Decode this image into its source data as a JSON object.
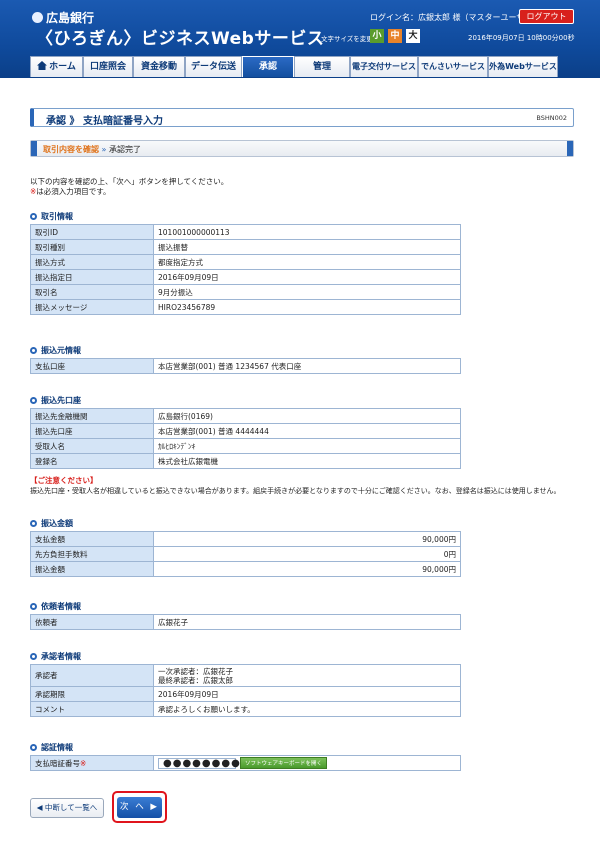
{
  "header": {
    "bank_name": "広島銀行",
    "service_name": "〈ひろぎん〉ビジネスWebサービス",
    "login_info": "ログイン名：広銀太郎 様（マスターユーザ）",
    "logout_label": "ログアウト",
    "font_size_label": "文字サイズを変更",
    "font_small": "小",
    "font_medium": "中",
    "font_large": "大",
    "datetime": "2016年09月07日 10時00分00秒"
  },
  "nav": {
    "tabs": [
      {
        "label": "ホーム"
      },
      {
        "label": "口座照会"
      },
      {
        "label": "資金移動"
      },
      {
        "label": "データ伝送"
      },
      {
        "label": "承認"
      },
      {
        "label": "管理"
      },
      {
        "label": "電子交付サービス"
      },
      {
        "label": "でんさいサービス"
      },
      {
        "label": "外為Webサービス"
      }
    ],
    "active_tab": "承認"
  },
  "page": {
    "title": "承認 》 支払暗証番号入力",
    "screen_id": "BSHN002",
    "step_current": "取引内容を確認",
    "step_sep": "»",
    "step_next": "承認完了",
    "intro_line1": "以下の内容を確認の上、「次へ」ボタンを押してください。",
    "intro_required_mark": "※",
    "intro_line2": "は必須入力項目です。"
  },
  "sections": {
    "transaction": {
      "title": "取引情報",
      "rows": [
        {
          "label": "取引ID",
          "value": "101001000000113"
        },
        {
          "label": "取引種別",
          "value": "振込振替"
        },
        {
          "label": "振込方式",
          "value": "都度指定方式"
        },
        {
          "label": "振込指定日",
          "value": "2016年09月09日"
        },
        {
          "label": "取引名",
          "value": "9月分振込"
        },
        {
          "label": "振込メッセージ",
          "value": "HIRO23456789"
        }
      ]
    },
    "source": {
      "title": "振込元情報",
      "rows": [
        {
          "label": "支払口座",
          "value": "本店営業部(001) 普通 1234567 代表口座"
        }
      ]
    },
    "destination": {
      "title": "振込先口座",
      "rows": [
        {
          "label": "振込先金融機関",
          "value": "広島銀行(0169)"
        },
        {
          "label": "振込先口座",
          "value": "本店営業部(001) 普通 4444444"
        },
        {
          "label": "受取人名",
          "value": "ｶﾙﾋﾛｷﾝﾃﾞﾝｷ"
        },
        {
          "label": "登録名",
          "value": "株式会社広銀電機"
        }
      ],
      "caution_title": "【ご注意ください】",
      "caution_text": "振込先口座・受取人名が相違していると振込できない場合があります。組戻手続きが必要となりますので十分にご確認ください。なお、登録名は振込には使用しません。"
    },
    "amount": {
      "title": "振込金額",
      "rows": [
        {
          "label": "支払金額",
          "value": "90,000円"
        },
        {
          "label": "先方負担手数料",
          "value": "0円"
        },
        {
          "label": "振込金額",
          "value": "90,000円"
        }
      ]
    },
    "requester": {
      "title": "依頼者情報",
      "rows": [
        {
          "label": "依頼者",
          "value": "広銀花子"
        }
      ]
    },
    "approver": {
      "title": "承認者情報",
      "approver_label": "承認者",
      "approver_line1": "一次承認者：広銀花子",
      "approver_line2": "最終承認者：広銀太郎",
      "deadline_label": "承認期限",
      "deadline_value": "2016年09月09日",
      "comment_label": "コメント",
      "comment_value": "承認よろしくお願いします。"
    },
    "auth": {
      "title": "認証情報",
      "pin_label": "支払暗証番号",
      "pin_required": "※",
      "pin_value": "●●●●●●●●",
      "keyboard_label": "ソフトウェアキーボードを開く"
    }
  },
  "buttons": {
    "back_label": "◀ 中断して一覧へ",
    "next_label": "次 へ ▶"
  }
}
